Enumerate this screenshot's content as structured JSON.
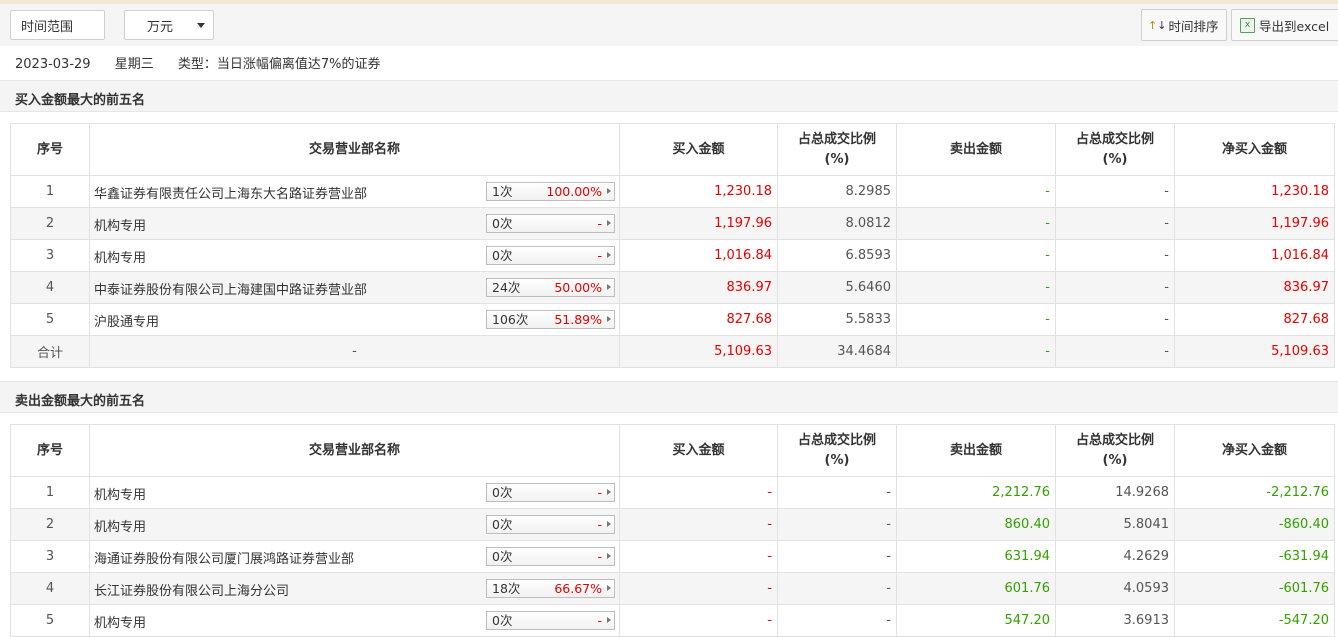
{
  "toolbar": {
    "time_range_label": "时间范围",
    "unit_label": "万元",
    "sort_label": "时间排序",
    "export_label": "导出到excel"
  },
  "info": {
    "date": "2023-03-29",
    "weekday": "星期三",
    "type": "类型：当日涨幅偏离值达7%的证券"
  },
  "columns": [
    "序号",
    "交易营业部名称",
    "买入金额",
    "占总成交比例(%)",
    "卖出金额",
    "占总成交比例(%)",
    "净买入金额"
  ],
  "buy_section": {
    "title": "买入金额最大的前五名",
    "rows": [
      {
        "idx": "1",
        "name": "华鑫证券有限责任公司上海东大名路证券营业部",
        "count": "1次",
        "pct": "100.00%",
        "buy": "1,230.18",
        "buy_ratio": "8.2985",
        "sell": "-",
        "sell_ratio": "-",
        "net": "1,230.18"
      },
      {
        "idx": "2",
        "name": "机构专用",
        "count": "0次",
        "pct": "-",
        "buy": "1,197.96",
        "buy_ratio": "8.0812",
        "sell": "-",
        "sell_ratio": "-",
        "net": "1,197.96"
      },
      {
        "idx": "3",
        "name": "机构专用",
        "count": "0次",
        "pct": "-",
        "buy": "1,016.84",
        "buy_ratio": "6.8593",
        "sell": "-",
        "sell_ratio": "-",
        "net": "1,016.84"
      },
      {
        "idx": "4",
        "name": "中泰证券股份有限公司上海建国中路证券营业部",
        "count": "24次",
        "pct": "50.00%",
        "buy": "836.97",
        "buy_ratio": "5.6460",
        "sell": "-",
        "sell_ratio": "-",
        "net": "836.97"
      },
      {
        "idx": "5",
        "name": "沪股通专用",
        "count": "106次",
        "pct": "51.89%",
        "buy": "827.68",
        "buy_ratio": "5.5833",
        "sell": "-",
        "sell_ratio": "-",
        "net": "827.68"
      }
    ],
    "total": {
      "idx": "合计",
      "name": "-",
      "buy": "5,109.63",
      "buy_ratio": "34.4684",
      "sell": "-",
      "sell_ratio": "-",
      "net": "5,109.63"
    }
  },
  "sell_section": {
    "title": "卖出金额最大的前五名",
    "rows": [
      {
        "idx": "1",
        "name": "机构专用",
        "count": "0次",
        "pct": "-",
        "buy": "-",
        "buy_ratio": "-",
        "sell": "2,212.76",
        "sell_ratio": "14.9268",
        "net": "-2,212.76"
      },
      {
        "idx": "2",
        "name": "机构专用",
        "count": "0次",
        "pct": "-",
        "buy": "-",
        "buy_ratio": "-",
        "sell": "860.40",
        "sell_ratio": "5.8041",
        "net": "-860.40"
      },
      {
        "idx": "3",
        "name": "海通证券股份有限公司厦门展鸿路证券营业部",
        "count": "0次",
        "pct": "-",
        "buy": "-",
        "buy_ratio": "-",
        "sell": "631.94",
        "sell_ratio": "4.2629",
        "net": "-631.94"
      },
      {
        "idx": "4",
        "name": "长江证券股份有限公司上海分公司",
        "count": "18次",
        "pct": "66.67%",
        "buy": "-",
        "buy_ratio": "-",
        "sell": "601.76",
        "sell_ratio": "4.0593",
        "net": "-601.76"
      },
      {
        "idx": "5",
        "name": "机构专用",
        "count": "0次",
        "pct": "-",
        "buy": "-",
        "buy_ratio": "-",
        "sell": "547.20",
        "sell_ratio": "3.6913",
        "net": "-547.20"
      }
    ]
  }
}
